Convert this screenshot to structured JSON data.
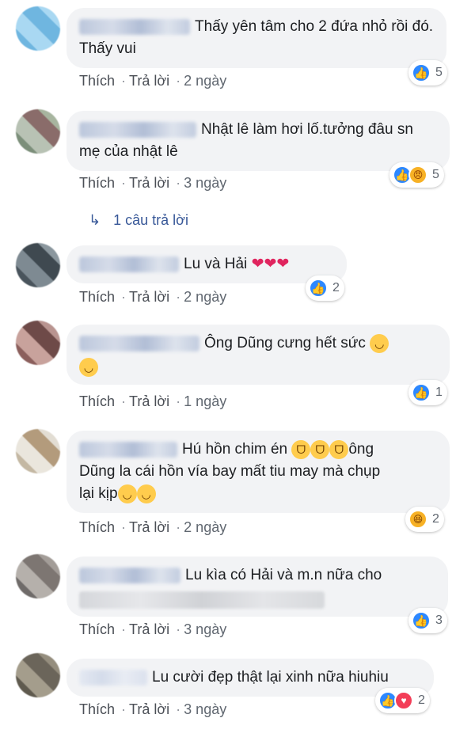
{
  "comments": [
    {
      "text": "Thấy yên tâm cho 2 đứa nhỏ rồi đó. Thấy vui",
      "like": "Thích",
      "reply": "Trả lời",
      "time": "2 ngày",
      "reactions": "5"
    },
    {
      "text": "Nhật lê làm hơi lố.tưởng đâu sn mẹ của nhật lê",
      "like": "Thích",
      "reply": "Trả lời",
      "time": "3 ngày",
      "reactions": "5",
      "replies_link": "1 câu trả lời"
    },
    {
      "text": "Lu và Hải",
      "emoji": "❤❤❤",
      "like": "Thích",
      "reply": "Trả lời",
      "time": "2 ngày",
      "reactions": "2"
    },
    {
      "text": "Ông Dũng cưng hết sức",
      "like": "Thích",
      "reply": "Trả lời",
      "time": "1 ngày",
      "reactions": "1"
    },
    {
      "text1": "Hú hồn chim én",
      "text2": "ông",
      "text3": "Dũng la cái hồn vía bay mất tiu may mà chụp",
      "text4": "lại kịp",
      "like": "Thích",
      "reply": "Trả lời",
      "time": "2 ngày",
      "reactions": "2"
    },
    {
      "text": "Lu kìa có Hải và m.n nữa cho",
      "like": "Thích",
      "reply": "Trả lời",
      "time": "3 ngày",
      "reactions": "3"
    },
    {
      "text": "Lu cười đẹp thật lại xinh nữa hiuhiu",
      "like": "Thích",
      "reply": "Trả lời",
      "time": "3 ngày",
      "reactions": "2"
    }
  ],
  "colors": {
    "link": "#385898",
    "bubble": "#f2f3f5",
    "like_blue": "#2d88ff"
  },
  "icons": [
    "like-icon",
    "angry-icon",
    "haha-icon",
    "love-icon",
    "reply-arrow-icon"
  ]
}
